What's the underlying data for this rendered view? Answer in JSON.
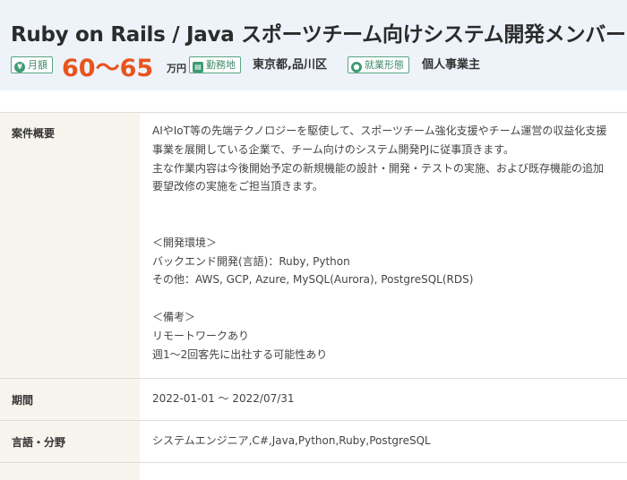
{
  "job": {
    "title": "Ruby on Rails / Java スポーツチーム向けシステム開発メンバー",
    "monthly_label": "月額",
    "price": "60〜65",
    "price_unit": "万円",
    "location_label": "勤務地",
    "location": "東京都,品川区",
    "employment_label": "就業形態",
    "employment": "個人事業主"
  },
  "details": {
    "overview_label": "案件概要",
    "overview_lines": [
      "AIやIoT等の先端テクノロジーを駆使して、スポーツチーム強化支援やチーム運営の収益化支援",
      "事業を展開している企業で、チーム向けのシステム開発PJに従事頂きます。",
      "主な作業内容は今後開始予定の新規機能の設計・開発・テストの実施、および既存機能の追加",
      "要望改修の実施をご担当頂きます。",
      "",
      "",
      "＜開発環境＞",
      "バックエンド開発(言語)：Ruby, Python",
      "その他：AWS, GCP, Azure, MySQL(Aurora), PostgreSQL(RDS)",
      "",
      "＜備考＞",
      "リモートワークあり",
      "週1〜2回客先に出社する可能性あり"
    ],
    "period_label": "期間",
    "period": "2022-01-01 〜 2022/07/31",
    "skills_label": "言語・分野",
    "skills": "システムエンジニア,C#,Java,Python,Ruby,PostgreSQL"
  },
  "colors": {
    "header_bg": "#eef3fa",
    "accent_price": "#e8541e",
    "badge_green": "#3f9a73",
    "label_bg": "#f7f4ee"
  }
}
